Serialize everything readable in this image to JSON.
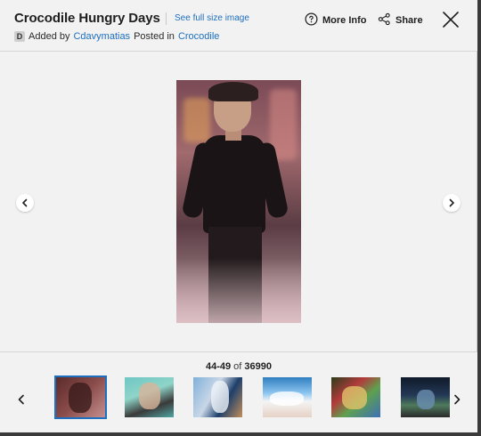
{
  "header": {
    "title": "Crocodile Hungry Days",
    "full_size_link": "See full size image",
    "added_by_prefix": "Added by",
    "author": "Cdavymatias",
    "posted_in_prefix": "Posted in",
    "category": "Crocodile",
    "more_info_label": "More Info",
    "share_label": "Share"
  },
  "carousel": {
    "range": "44-49",
    "of_word": "of",
    "total": "36990"
  },
  "icons": {
    "wiki_badge": "D",
    "more_info": "question-circle-icon",
    "share": "share-nodes-icon",
    "close": "close-icon",
    "prev": "chevron-left-icon",
    "next": "chevron-right-icon"
  },
  "colors": {
    "link": "#1d6fbf",
    "background": "#f2f2f2",
    "active_thumb_border": "#1d6fbf"
  }
}
